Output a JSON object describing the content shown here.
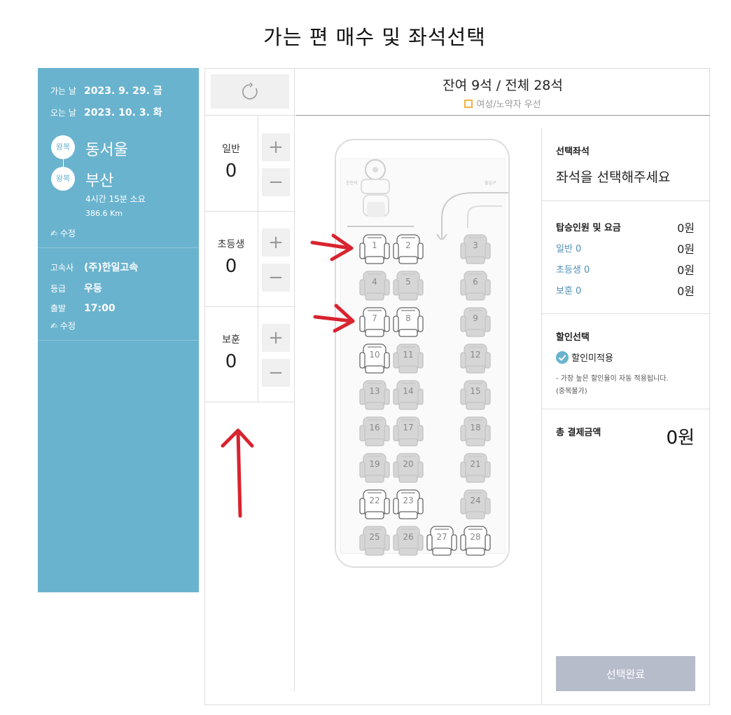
{
  "page": {
    "title": "가는 편 매수 및 좌석선택"
  },
  "trip": {
    "depart_label": "가는 날",
    "depart_value": "2023. 9. 29. 금",
    "return_label": "오는 날",
    "return_value": "2023. 10. 3. 화",
    "from_badge": "왕복",
    "from_city": "동서울",
    "to_badge": "왕복",
    "to_city": "부산",
    "duration": "4시간 15분 소요",
    "distance": "386.6 Km",
    "edit_label": "수정",
    "company_label": "고속사",
    "company_value": "(주)한일고속",
    "grade_label": "등급",
    "grade_value": "우등",
    "time_label": "출발",
    "time_value": "17:00",
    "edit2_label": "수정"
  },
  "passengers": [
    {
      "label": "일반",
      "count": "0"
    },
    {
      "label": "초등생",
      "count": "0"
    },
    {
      "label": "보훈",
      "count": "0"
    }
  ],
  "controls": {
    "plus": "+",
    "minus": "−"
  },
  "seats_header": {
    "summary": "잔여 9석 / 전체 28석",
    "priority_legend": "여성/노약자 우선"
  },
  "bus": {
    "driver_label": "운전석",
    "door_label": "출입구"
  },
  "seats": [
    {
      "num": "1",
      "available": true
    },
    {
      "num": "2",
      "available": true
    },
    {
      "num": "3",
      "available": false
    },
    {
      "num": "4",
      "available": false
    },
    {
      "num": "5",
      "available": false
    },
    {
      "num": "6",
      "available": false
    },
    {
      "num": "7",
      "available": true
    },
    {
      "num": "8",
      "available": true
    },
    {
      "num": "9",
      "available": false
    },
    {
      "num": "10",
      "available": true
    },
    {
      "num": "11",
      "available": false
    },
    {
      "num": "12",
      "available": false
    },
    {
      "num": "13",
      "available": false
    },
    {
      "num": "14",
      "available": false
    },
    {
      "num": "15",
      "available": false
    },
    {
      "num": "16",
      "available": false
    },
    {
      "num": "17",
      "available": false
    },
    {
      "num": "18",
      "available": false
    },
    {
      "num": "19",
      "available": false
    },
    {
      "num": "20",
      "available": false
    },
    {
      "num": "21",
      "available": false
    },
    {
      "num": "22",
      "available": true
    },
    {
      "num": "23",
      "available": true
    },
    {
      "num": "24",
      "available": false
    },
    {
      "num": "25",
      "available": false
    },
    {
      "num": "26",
      "available": false
    },
    {
      "num": "27",
      "available": true
    },
    {
      "num": "28",
      "available": true
    }
  ],
  "selection": {
    "selected_title": "선택좌석",
    "selected_placeholder": "좌석을 선택해주세요",
    "fare_title": "탑승인원 및 요금",
    "fare_total": "0원",
    "fares": [
      {
        "name": "일반 0",
        "amount": "0원"
      },
      {
        "name": "초등생 0",
        "amount": "0원"
      },
      {
        "name": "보훈 0",
        "amount": "0원"
      }
    ],
    "discount_title": "할인선택",
    "discount_option": "할인미적용",
    "discount_note_1": "- 가장 높은 할인율이 자동 적용됩니다.",
    "discount_note_2": "(중복불가)",
    "total_title": "총 결제금액",
    "total_amount": "0원",
    "confirm_label": "선택완료"
  },
  "colors": {
    "panel": "#6ab3ce",
    "priority": "#f2b440",
    "check": "#6ab3ce",
    "annotation": "#d9232f",
    "confirm": "#b7bccb"
  }
}
